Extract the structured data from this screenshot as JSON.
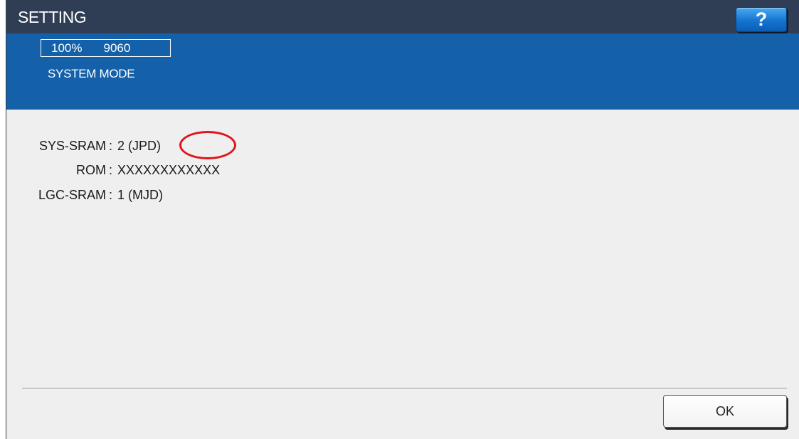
{
  "header": {
    "title": "SETTING",
    "help_label": "?"
  },
  "status": {
    "zoom": "100%",
    "count": "9060",
    "mode": "SYSTEM MODE"
  },
  "info": {
    "rows": [
      {
        "label": "SYS-SRAM",
        "separator": ":",
        "value": "2 (JPD)"
      },
      {
        "label": "ROM",
        "separator": ":",
        "value": "XXXXXXXXXXXX"
      },
      {
        "label": "LGC-SRAM",
        "separator": ":",
        "value": "1 (MJD)"
      }
    ]
  },
  "footer": {
    "ok_label": "OK"
  },
  "colors": {
    "title_bar": "#2f3e55",
    "header_band": "#1460a9",
    "highlight_circle": "#e0141c",
    "help_button": "#1474d1"
  }
}
